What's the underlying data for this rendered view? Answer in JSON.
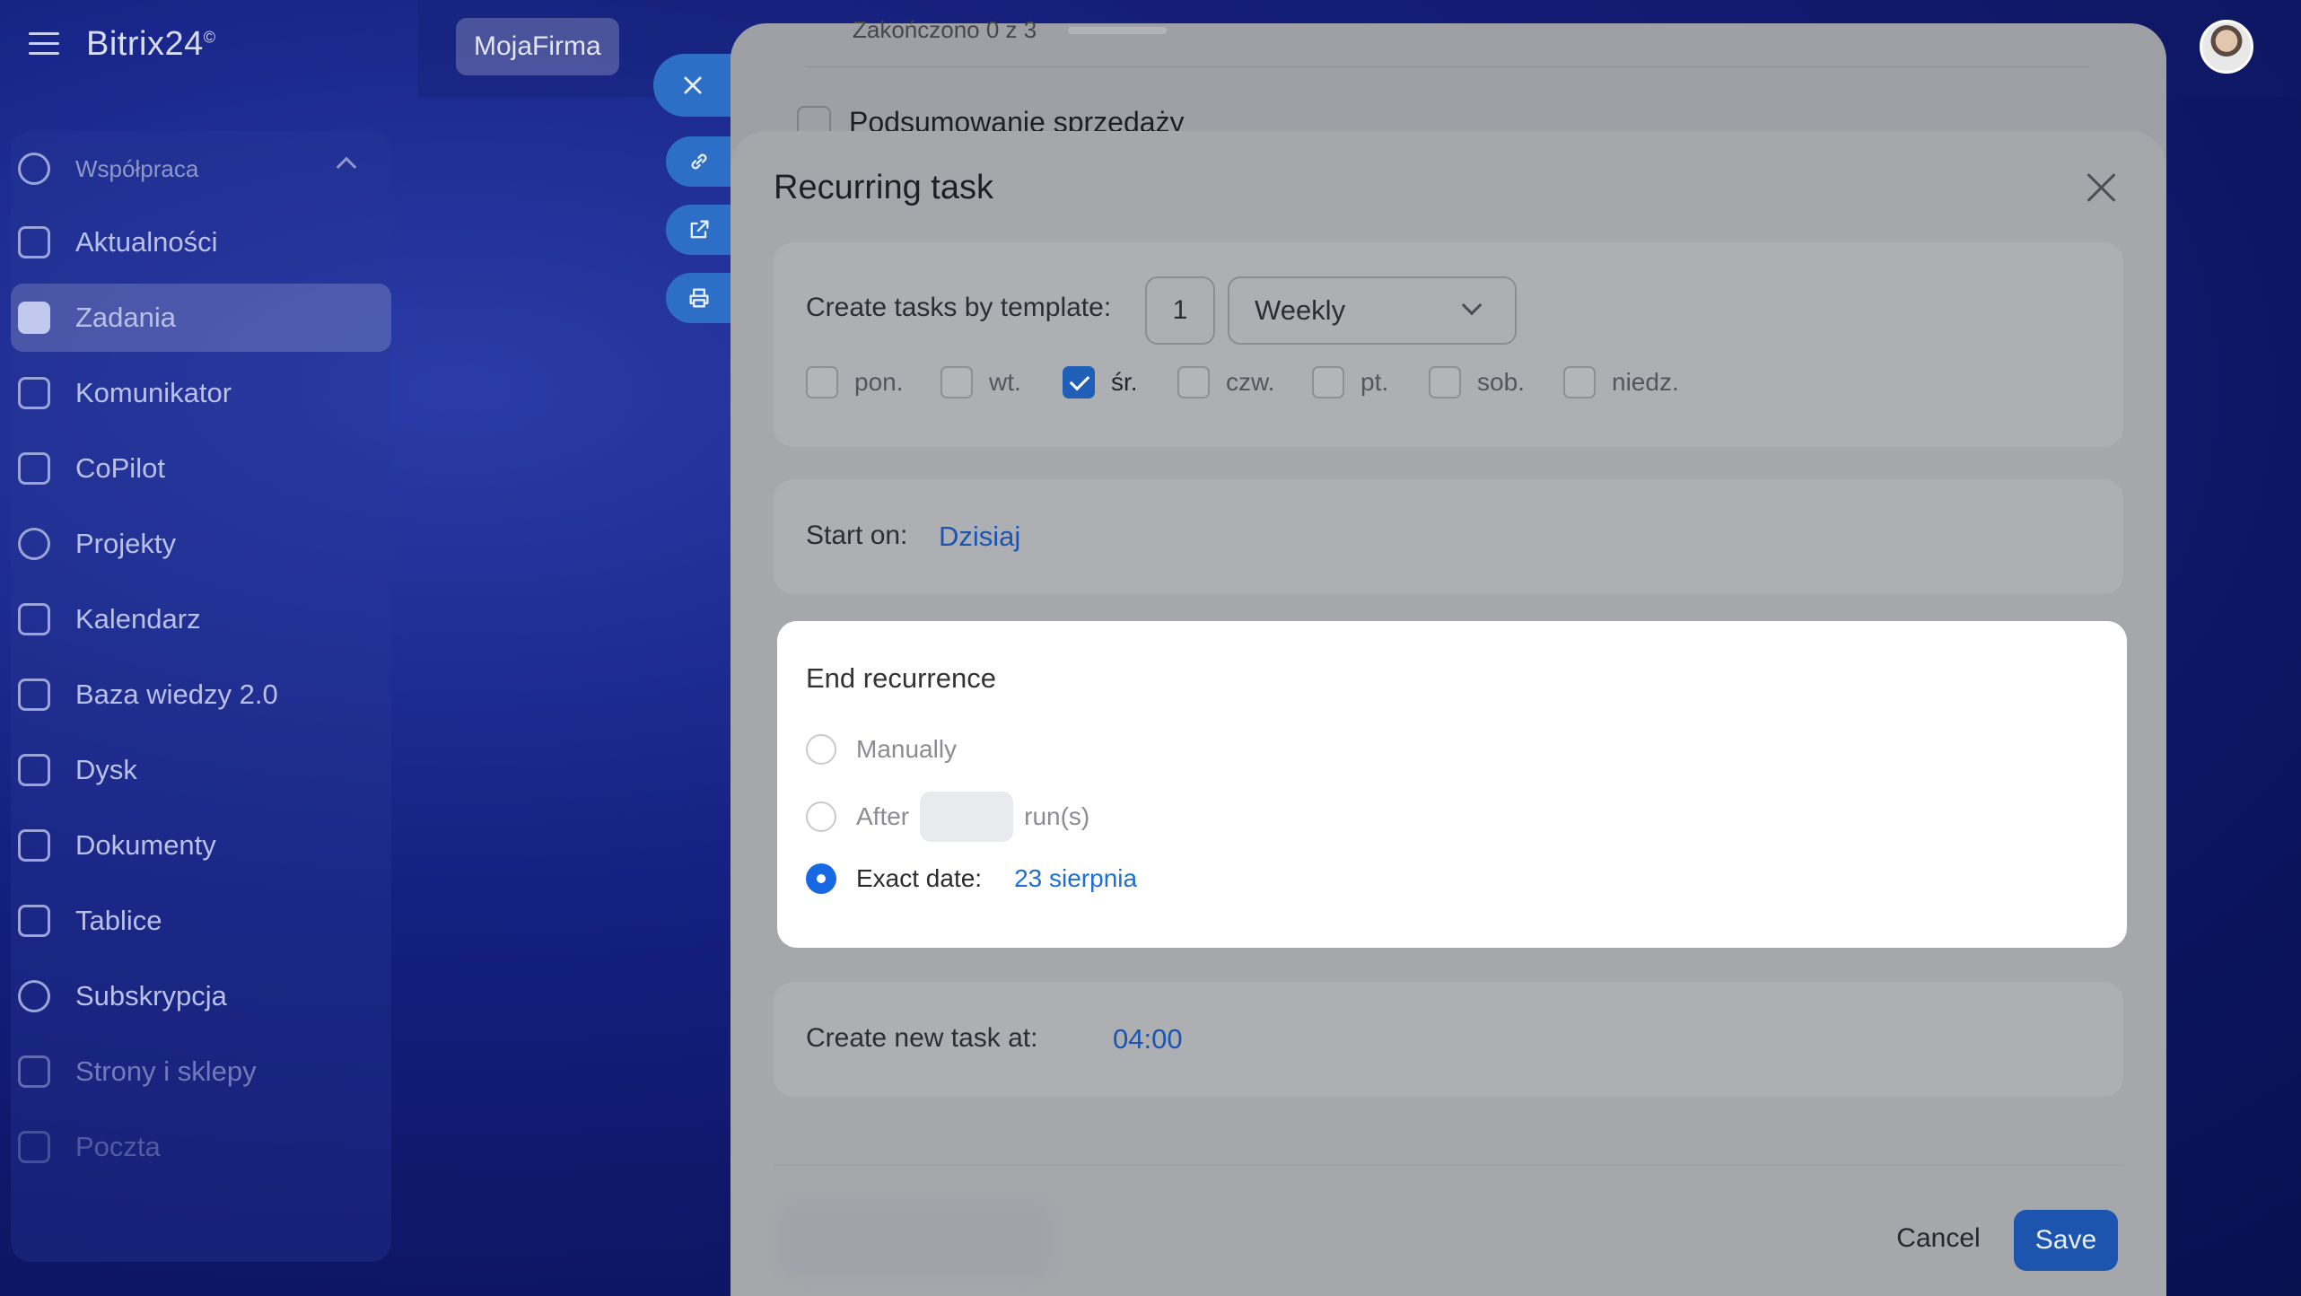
{
  "app": {
    "logo": "Bitrix24",
    "logo_mark": "©",
    "company": "MojaFirma"
  },
  "sidebar": {
    "group_label": "Współpraca",
    "items": [
      {
        "label": "Aktualności",
        "icon": "news-icon"
      },
      {
        "label": "Zadania",
        "icon": "tasks-icon",
        "active": true
      },
      {
        "label": "Komunikator",
        "icon": "chat-icon"
      },
      {
        "label": "CoPilot",
        "icon": "copilot-icon"
      },
      {
        "label": "Projekty",
        "icon": "projects-icon"
      },
      {
        "label": "Kalendarz",
        "icon": "calendar-icon"
      },
      {
        "label": "Baza wiedzy 2.0",
        "icon": "knowledge-icon"
      },
      {
        "label": "Dysk",
        "icon": "drive-icon"
      },
      {
        "label": "Dokumenty",
        "icon": "documents-icon"
      },
      {
        "label": "Tablice",
        "icon": "boards-icon"
      },
      {
        "label": "Subskrypcja",
        "icon": "subscription-icon"
      },
      {
        "label": "Strony i sklepy",
        "icon": "cart-icon"
      },
      {
        "label": "Poczta",
        "icon": "mail-icon"
      }
    ]
  },
  "task_behind": {
    "progress_text": "Zakończono 0 z 3",
    "checklist_item": "Podsumowanie sprzedaży"
  },
  "popup": {
    "title": "Recurring task",
    "template": {
      "label": "Create tasks by template:",
      "interval": "1",
      "period": "Weekly",
      "days": [
        {
          "label": "pon.",
          "checked": false
        },
        {
          "label": "wt.",
          "checked": false
        },
        {
          "label": "śr.",
          "checked": true
        },
        {
          "label": "czw.",
          "checked": false
        },
        {
          "label": "pt.",
          "checked": false
        },
        {
          "label": "sob.",
          "checked": false
        },
        {
          "label": "niedz.",
          "checked": false
        }
      ]
    },
    "start": {
      "label": "Start on:",
      "value": "Dzisiaj"
    },
    "end": {
      "title": "End recurrence",
      "manually": "Manually",
      "after": "After",
      "after_runs": "",
      "runs_suffix": "run(s)",
      "exact_date": "Exact date:",
      "exact_date_value": "23 sierpnia",
      "selected": "exact_date"
    },
    "create_time": {
      "label": "Create new task at:",
      "value": "04:00"
    },
    "buttons": {
      "cancel": "Cancel",
      "save": "Save"
    }
  },
  "colors": {
    "accent": "#1668e3",
    "link": "#1d6ed8",
    "save": "#1c54ae",
    "background": "#142080"
  }
}
